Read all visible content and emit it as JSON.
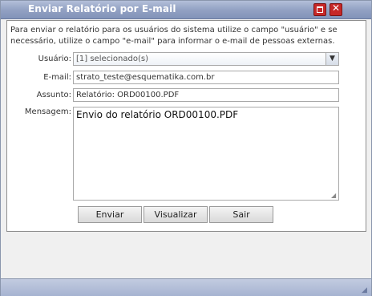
{
  "window": {
    "title": "Enviar Relatório por E-mail"
  },
  "form": {
    "description": "Para enviar o relatório para os usuários do sistema utilize o campo \"usuário\" e se necessário, utilize o campo \"e-mail\" para informar o e-mail de pessoas externas.",
    "usuario_label": "Usuário:",
    "usuario_value": "[1] selecionado(s)",
    "email_label": "E-mail:",
    "email_value": "strato_teste@esquematika.com.br",
    "assunto_label": "Assunto:",
    "assunto_value": "Relatório: ORD00100.PDF",
    "mensagem_label": "Mensagem:",
    "mensagem_value": "Envio do relatório ORD00100.PDF"
  },
  "buttons": {
    "enviar": "Enviar",
    "visualizar": "Visualizar",
    "sair": "Sair"
  }
}
